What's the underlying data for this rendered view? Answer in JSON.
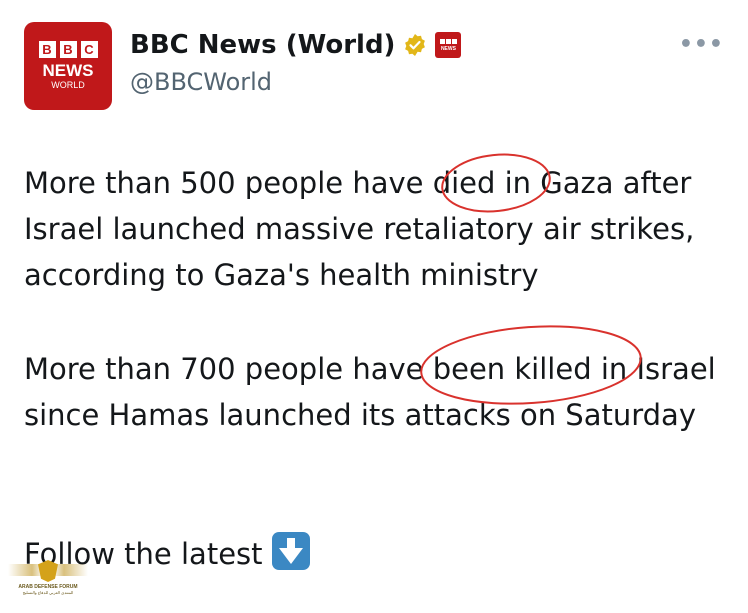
{
  "account": {
    "avatar_top": "BBC",
    "avatar_middle": "NEWS",
    "avatar_bottom": "WORLD",
    "display_name": "BBC News (World)",
    "handle": "@BBCWorld",
    "verified_badge_color": "#e2b719",
    "brand_color": "#c0181a",
    "affiliate_badge_text": "NEWS"
  },
  "more_menu": "•••",
  "tweet": {
    "paragraph1": "More than 500 people have died in Gaza after Israel launched massive retaliatory air strikes, according to Gaza's health ministry",
    "paragraph2": "More than 700 people have been killed in Israel since Hamas launched its attacks on Saturday",
    "follow_text": "Follow the latest",
    "follow_emoji": "down-arrow-icon"
  },
  "annotation_color": "#d9322d",
  "watermark": {
    "title": "ARAB DEFENSE FORUM",
    "subtitle": "المنتدى العربي للدفاع والتسليح"
  }
}
